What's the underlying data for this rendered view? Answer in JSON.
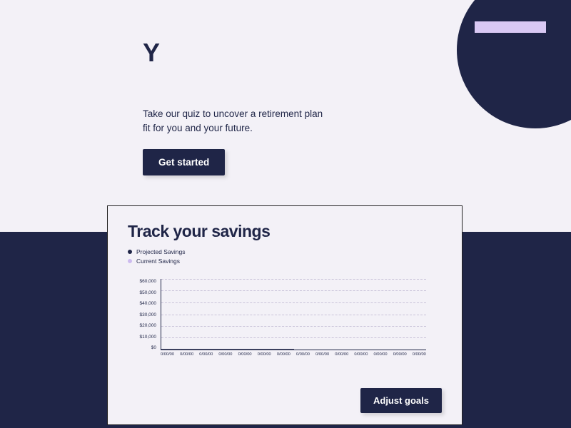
{
  "hero": {
    "title_partial": "Y",
    "subtitle": "Take our quiz to uncover a retirement plan fit for you and your future.",
    "cta_label": "Get started"
  },
  "card": {
    "title": "Track your savings",
    "legend": {
      "projected": "Projected Savings",
      "current": "Current Savings"
    },
    "cta_label": "Adjust goals"
  },
  "chart_data": {
    "type": "line",
    "ylabel": "",
    "xlabel": "",
    "ylim": [
      0,
      60000
    ],
    "y_ticks": [
      "$60,000",
      "$50,000",
      "$40,000",
      "$30,000",
      "$20,000",
      "$10,000",
      "$0"
    ],
    "x_ticks": [
      "0/00/00",
      "0/00/00",
      "0/00/00",
      "0/00/00",
      "0/00/00",
      "0/00/00",
      "0/00/00",
      "0/00/00",
      "0/00/00",
      "0/00/00",
      "0/00/00",
      "0/00/00",
      "0/00/00",
      "0/00/00"
    ],
    "series": [
      {
        "name": "Projected Savings",
        "values": [
          0,
          0,
          0,
          0,
          0,
          0,
          0,
          0,
          0,
          0,
          0,
          0,
          0,
          0
        ]
      },
      {
        "name": "Current Savings",
        "values": [
          0,
          0,
          0,
          0,
          0,
          0,
          0,
          0,
          0,
          0,
          0,
          0,
          0,
          0
        ]
      }
    ],
    "colors": {
      "projected": "#1f2547",
      "current": "#cdbbef"
    }
  }
}
